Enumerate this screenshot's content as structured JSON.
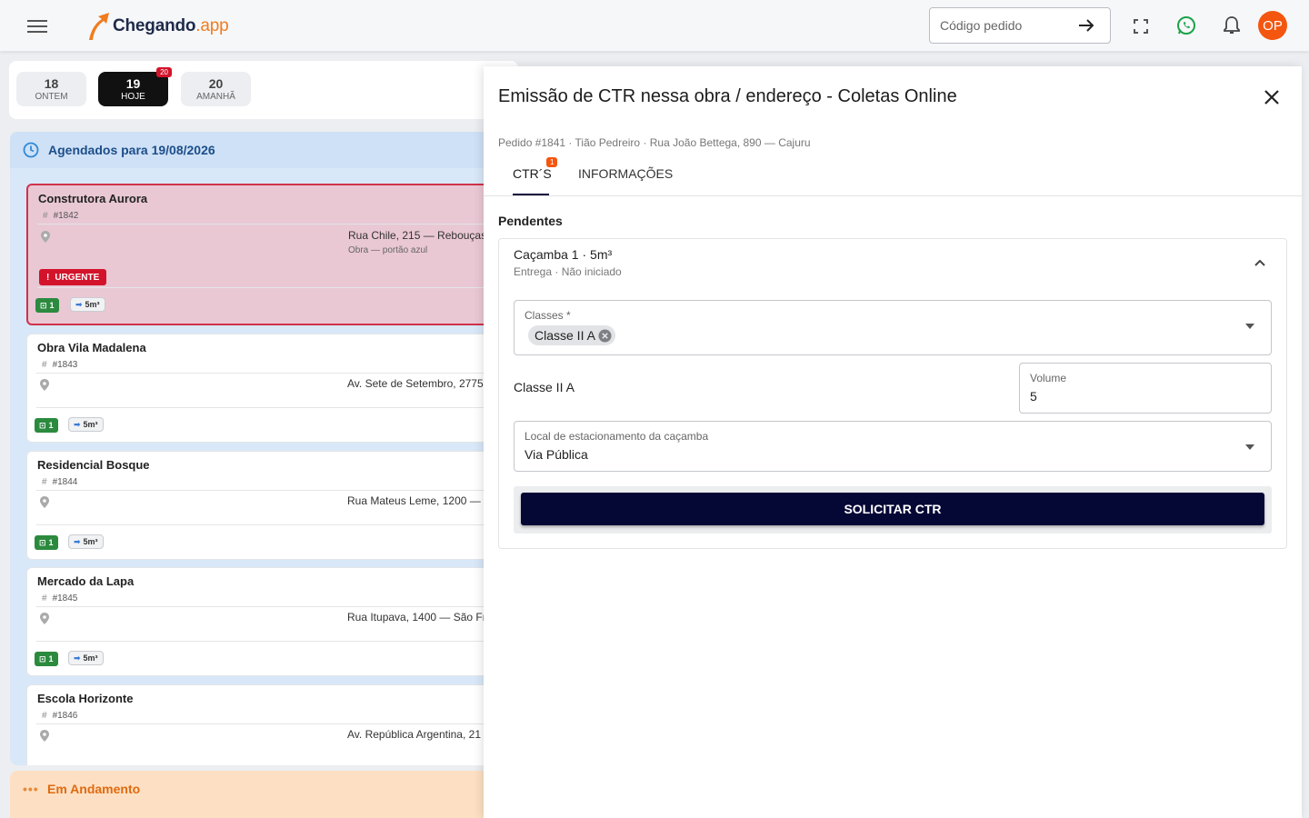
{
  "header": {
    "logo_main": "Chegando",
    "logo_suffix": ".app",
    "search_placeholder": "Código pedido",
    "avatar_initials": "OP",
    "icons": [
      "menu-icon",
      "arrow-right-icon",
      "fullscreen-icon",
      "whatsapp-icon",
      "bell-icon"
    ]
  },
  "dates": [
    {
      "day": "18",
      "label": "ONTEM"
    },
    {
      "day": "19",
      "label": "HOJE",
      "badge": "20"
    },
    {
      "day": "20",
      "label": "AMANHÃ"
    }
  ],
  "schedule": {
    "title": "Agendados para 19/08/2026",
    "orders": [
      {
        "name": "Construtora Aurora",
        "number": "#1842",
        "address": "Rua Chile, 215 — Rebouças",
        "note": "Obra — portão azul",
        "urgent_label": "URGENTE",
        "count": "1",
        "size": "5m³"
      },
      {
        "name": "Obra Vila Madalena",
        "number": "#1843",
        "address": "Av. Sete de Setembro, 2775",
        "count": "1",
        "size": "5m³"
      },
      {
        "name": "Residencial Bosque",
        "number": "#1844",
        "address": "Rua Mateus Leme, 1200 —",
        "count": "1",
        "size": "5m³"
      },
      {
        "name": "Mercado da Lapa",
        "number": "#1845",
        "address": "Rua Itupava, 1400 — São Fr",
        "count": "1",
        "size": "5m³"
      },
      {
        "name": "Escola Horizonte",
        "number": "#1846",
        "address": "Av. República Argentina, 21"
      }
    ]
  },
  "in_progress": {
    "title": "Em Andamento"
  },
  "panel": {
    "title": "Emissão de CTR nessa obra / endereço - Coletas Online",
    "subtitle": "Pedido #1841 · Tião Pedreiro · Rua João Bettega, 890 — Cajuru",
    "tabs": [
      {
        "label": "CTR´S",
        "badge": "1"
      },
      {
        "label": "INFORMAÇÕES"
      }
    ],
    "section_label": "Pendentes",
    "container": {
      "title": "Caçamba 1 · 5m³",
      "status": "Entrega · Não iniciado",
      "classes_label": "Classes *",
      "selected_class": "Classe II A",
      "class_row_label": "Classe II A",
      "volume_label": "Volume",
      "volume_value": "5",
      "parking_label": "Local de estacionamento da caçamba",
      "parking_value": "Via Pública",
      "submit_label": "SOLICITAR CTR"
    }
  },
  "colors": {
    "brand_orange": "#f07c1e",
    "brand_navy": "#1e2a4a",
    "submit_button": "#050735",
    "urgent_red": "#d3132b",
    "avatar": "#f4560f"
  }
}
